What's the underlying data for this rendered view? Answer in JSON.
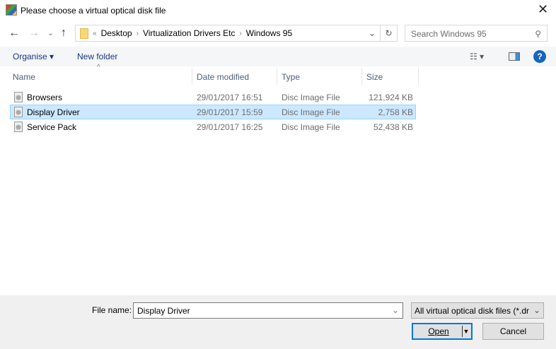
{
  "window": {
    "title": "Please choose a virtual optical disk file",
    "close": "✕"
  },
  "nav": {
    "back": "←",
    "forward": "→",
    "recent": "⌄",
    "up": "↑"
  },
  "address": {
    "prefix": "«",
    "crumbs": [
      "Desktop",
      "Virtualization Drivers Etc",
      "Windows 95"
    ],
    "dropdown": "⌄",
    "refresh": "↻"
  },
  "search": {
    "placeholder": "Search Windows 95",
    "icon": "⚲"
  },
  "toolbar": {
    "organise": "Organise ▾",
    "new_folder": "New folder",
    "view": "☷ ▾",
    "help": "?"
  },
  "columns": {
    "name": "Name",
    "date": "Date modified",
    "type": "Type",
    "size": "Size",
    "sort": "^"
  },
  "files": [
    {
      "name": "Browsers",
      "date": "29/01/2017 16:51",
      "type": "Disc Image File",
      "size": "121,924 KB"
    },
    {
      "name": "Display Driver",
      "date": "29/01/2017 15:59",
      "type": "Disc Image File",
      "size": "2,758 KB"
    },
    {
      "name": "Service Pack",
      "date": "29/01/2017 16:25",
      "type": "Disc Image File",
      "size": "52,438 KB"
    }
  ],
  "footer": {
    "file_name_label": "File name:",
    "file_name_value": "Display Driver",
    "filter": "All virtual optical disk files (*.dr",
    "open": "Open",
    "cancel": "Cancel"
  }
}
